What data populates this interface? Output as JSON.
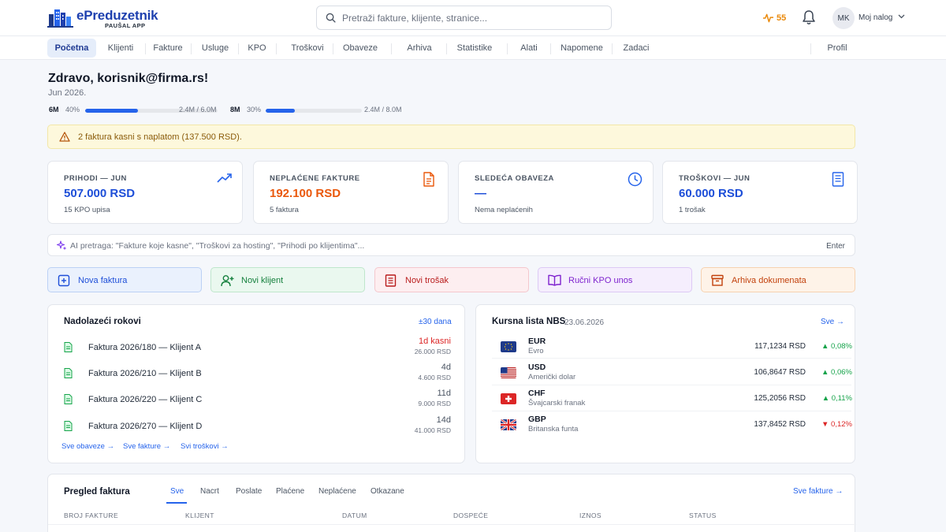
{
  "header": {
    "brand_name": "ePreduzetnik",
    "brand_sub": "PAUŠAL APP",
    "search_placeholder": "Pretraži fakture, klijente, stranice...",
    "pulse_count": "55",
    "avatar_initials": "MK",
    "account_label": "Moj nalog"
  },
  "nav": {
    "tabs": [
      "Početna",
      "Klijenti",
      "Fakture",
      "Usluge",
      "KPO",
      "Troškovi",
      "Obaveze",
      "Arhiva",
      "Statistike",
      "Alati",
      "Napomene",
      "Zadaci",
      "Profil"
    ],
    "active": "Početna"
  },
  "greeting": {
    "title": "Zdravo, korisnik@firma.rs!",
    "date": "Jun 2026."
  },
  "limits": [
    {
      "label": "6M",
      "percent_text": "40%",
      "progress": 0.4,
      "amount": "2.4M / 6.0M"
    },
    {
      "label": "8M",
      "percent_text": "30%",
      "progress": 0.3,
      "amount": "2.4M / 8.0M"
    }
  ],
  "alert": {
    "text": "2 faktura kasni s naplatom (137.500 RSD).",
    "icon": "warning-icon"
  },
  "cards": [
    {
      "title": "PRIHODI — JUN",
      "value": "507.000 RSD",
      "sub": "15 KPO upisa",
      "value_color": "#1d4ed8",
      "icon": "trending-up-icon"
    },
    {
      "title": "NEPLAĆENE FAKTURE",
      "value": "192.100 RSD",
      "sub": "5 faktura",
      "value_color": "#ea580c",
      "icon": "document-icon"
    },
    {
      "title": "SLEDEĆA OBAVEZA",
      "value": "—",
      "sub": "Nema neplaćenih",
      "value_color": "#1d4ed8",
      "icon": "clock-icon"
    },
    {
      "title": "TROŠKOVI — JUN",
      "value": "60.000 RSD",
      "sub": "1 trošak",
      "value_color": "#1d4ed8",
      "icon": "receipt-icon"
    }
  ],
  "ai_search": {
    "placeholder": "AI pretraga: \"Fakture koje kasne\", \"Troškovi za hosting\", \"Prihodi po klijentima\"...",
    "enter_label": "Enter"
  },
  "quick_actions": [
    {
      "label": "Nova faktura",
      "icon": "new-invoice-icon",
      "bg": "#eaf1fd",
      "border": "#bcd1f5",
      "color": "#1d4ed8"
    },
    {
      "label": "Novi klijent",
      "icon": "add-user-icon",
      "bg": "#eaf8ef",
      "border": "#bfe6cc",
      "color": "#15803d"
    },
    {
      "label": "Novi trošak",
      "icon": "expense-icon",
      "bg": "#fdeef0",
      "border": "#f4c7cd",
      "color": "#b91c1c"
    },
    {
      "label": "Ručni KPO unos",
      "icon": "book-icon",
      "bg": "#f5eefd",
      "border": "#ddc9f5",
      "color": "#7e22ce"
    },
    {
      "label": "Arhiva dokumenata",
      "icon": "archive-icon",
      "bg": "#fef3e8",
      "border": "#f6d2b0",
      "color": "#c2410c"
    }
  ],
  "deadlines": {
    "title": "Nadolazeći rokovi",
    "range": "±30 dana",
    "rows": [
      {
        "label": "Faktura 2026/180 — Klijent A",
        "days": "1d kasni",
        "amount": "26.000 RSD",
        "overdue": true
      },
      {
        "label": "Faktura 2026/210 — Klijent B",
        "days": "4d",
        "amount": "4.600 RSD",
        "overdue": false
      },
      {
        "label": "Faktura 2026/220 — Klijent C",
        "days": "11d",
        "amount": "9.000 RSD",
        "overdue": false
      },
      {
        "label": "Faktura 2026/270 — Klijent D",
        "days": "14d",
        "amount": "41.000 RSD",
        "overdue": false
      }
    ],
    "links": [
      "Sve obaveze →",
      "Sve fakture →",
      "Svi troškovi →"
    ]
  },
  "exchange": {
    "title": "Kursna lista NBS",
    "date": "23.06.2026",
    "link": "Sve →",
    "rows": [
      {
        "code": "EUR",
        "name": "Evro",
        "rate": "117,1234 RSD",
        "change": "▲ 0,08%",
        "up": true,
        "flag": "eu-flag-icon"
      },
      {
        "code": "USD",
        "name": "Američki dolar",
        "rate": "106,8647 RSD",
        "change": "▲ 0,06%",
        "up": true,
        "flag": "us-flag-icon"
      },
      {
        "code": "CHF",
        "name": "Švajcarski franak",
        "rate": "125,2056 RSD",
        "change": "▲ 0,11%",
        "up": true,
        "flag": "ch-flag-icon"
      },
      {
        "code": "GBP",
        "name": "Britanska funta",
        "rate": "137,8452 RSD",
        "change": "▼ 0,12%",
        "up": false,
        "flag": "gb-flag-icon"
      }
    ]
  },
  "invoices": {
    "title": "Pregled faktura",
    "filters": [
      "Sve",
      "Nacrt",
      "Poslate",
      "Plaćene",
      "Neplaćene",
      "Otkazane"
    ],
    "active_filter": "Sve",
    "link": "Sve fakture →",
    "columns": [
      "BROJ FAKTURE",
      "KLIJENT",
      "DATUM",
      "DOSPEĆE",
      "IZNOS",
      "STATUS"
    ]
  },
  "colors": {
    "accent": "#2563eb",
    "up": "#16a34a",
    "down": "#dc2626",
    "overdue": "#dc2626"
  }
}
